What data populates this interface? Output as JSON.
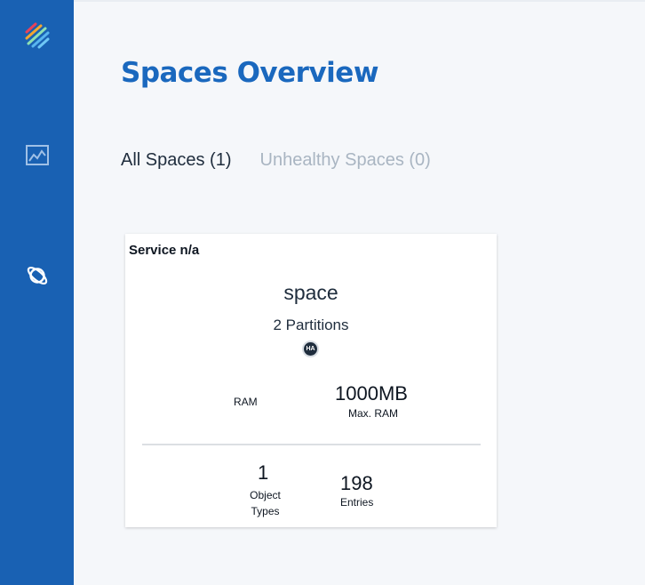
{
  "sidebar": {
    "logo_icon": "stripes-logo-icon",
    "items": [
      {
        "icon": "chart-icon",
        "name": "dashboard"
      },
      {
        "icon": "planet-icon",
        "name": "spaces"
      }
    ],
    "color": "#1961b3"
  },
  "page": {
    "title": "Spaces Overview",
    "title_color": "#1a68be"
  },
  "tabs": [
    {
      "label": "All Spaces (1)",
      "active": true
    },
    {
      "label": "Unhealthy Spaces (0)",
      "active": false
    }
  ],
  "card": {
    "service": "Service n/a",
    "space_name": "space",
    "partitions": "2 Partitions",
    "badge": "HA",
    "ram_label": "RAM",
    "max_ram_value": "1000MB",
    "max_ram_label": "Max. RAM",
    "object_types_value": "1",
    "object_types_label": "Object Types",
    "entries_value": "198",
    "entries_label": "Entries"
  }
}
